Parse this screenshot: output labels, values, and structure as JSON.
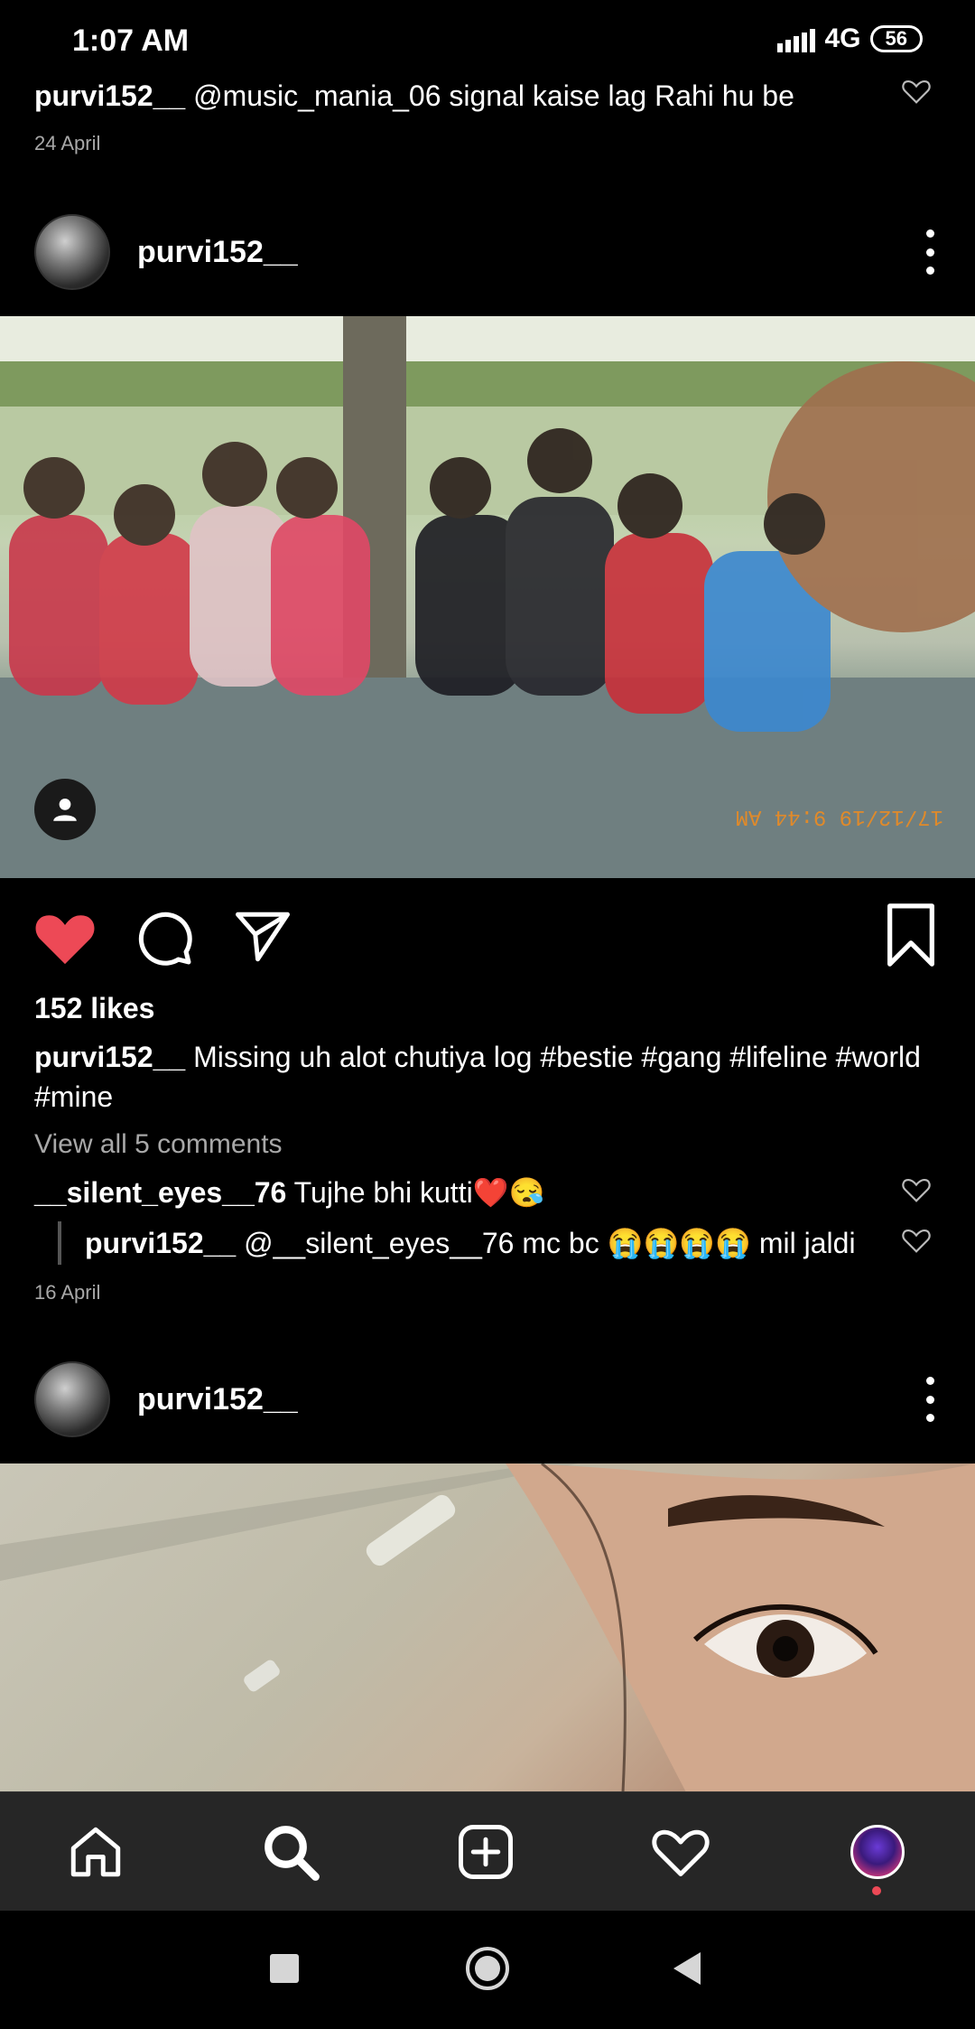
{
  "status_bar": {
    "time": "1:07 AM",
    "network": "4G",
    "battery": "56"
  },
  "prev_post": {
    "comment_user": "purvi152__",
    "comment_text": " @music_mania_06 signal kaise lag Rahi hu be",
    "date": "24 April"
  },
  "post1": {
    "username": "purvi152__",
    "photo_timestamp": "17/12/19 9:44 AM",
    "likes": "152 likes",
    "caption_user": "purvi152__",
    "caption_text": " Missing uh alot chutiya log #bestie #gang #lifeline #world #mine",
    "view_comments": "View all 5 comments",
    "comments": [
      {
        "user": "__silent_eyes__76",
        "text": " Tujhe bhi kutti❤️😪"
      },
      {
        "user": "purvi152__",
        "text": " @__silent_eyes__76 mc bc 😭😭😭😭 mil jaldi"
      }
    ],
    "date": "16 April"
  },
  "post2": {
    "username": "purvi152__"
  },
  "icons": {
    "like": "heart-icon",
    "comment": "comment-icon",
    "share": "send-icon",
    "save": "bookmark-icon",
    "more": "more-icon",
    "tag": "user-tag-icon",
    "home": "home-icon",
    "search": "search-icon",
    "add": "add-post-icon",
    "activity": "heart-icon",
    "profile": "profile-avatar"
  },
  "colors": {
    "like_red": "#ed4956",
    "background": "#000000",
    "nav_bg": "#262626",
    "secondary_text": "#a8a8a8"
  }
}
